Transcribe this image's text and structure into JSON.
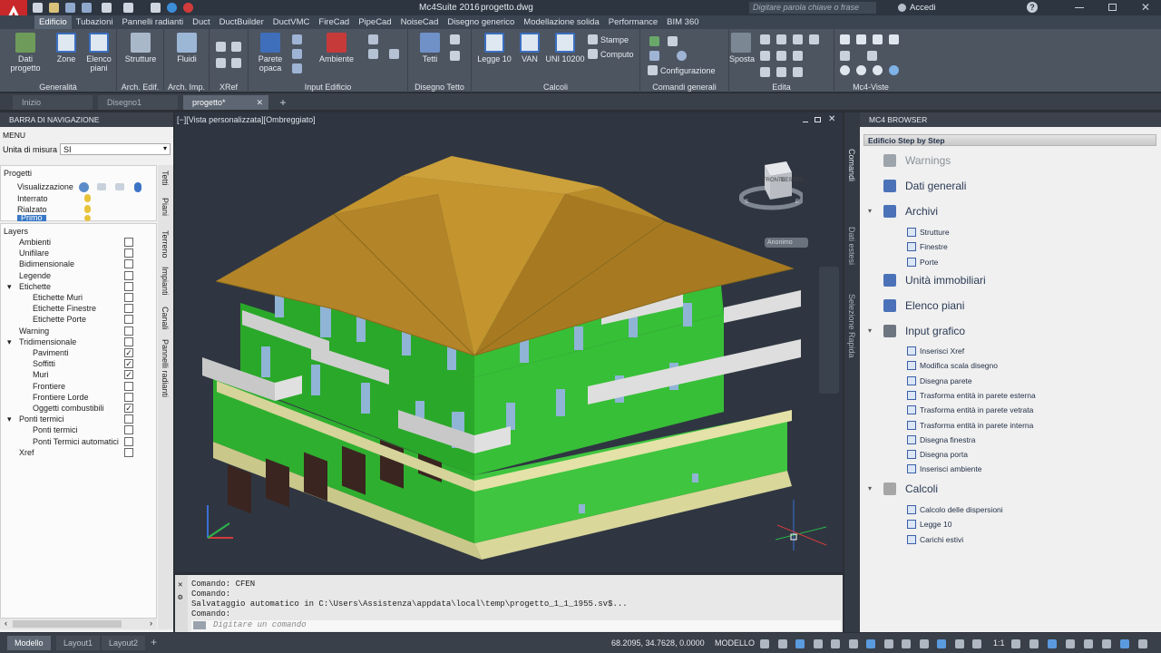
{
  "titlebar": {
    "app_title": "Mc4Suite 2016",
    "doc_title": "progetto.dwg",
    "search_placeholder": "Digitare parola chiave o frase",
    "user": "Accedi",
    "help": "?"
  },
  "ribbon_tabs": [
    "Edificio",
    "Tubazioni",
    "Pannelli radianti",
    "Duct",
    "DuctBuilder",
    "DuctVMC",
    "FireCad",
    "PipeCad",
    "NoiseCad",
    "Disegno generico",
    "Modellazione solida",
    "Performance",
    "BIM 360"
  ],
  "ribbon": {
    "generalita": {
      "title": "Generalità",
      "dati": "Dati\nprogetto",
      "zone": "Zone",
      "elenco": "Elenco\npiani"
    },
    "arch_edif": {
      "title": "Arch. Edif.",
      "strutture": "Strutture"
    },
    "arch_imp": {
      "title": "Arch. Imp.",
      "fluidi": "Fluidi"
    },
    "xref": {
      "title": "XRef"
    },
    "input": {
      "title": "Input Edificio",
      "parete": "Parete\nopaca",
      "ambiente": "Ambiente"
    },
    "tetto": {
      "title": "Disegno Tetto",
      "tetti": "Tetti"
    },
    "calcoli": {
      "title": "Calcoli",
      "legge10": "Legge 10",
      "van": "VAN",
      "uni": "UNI 10200",
      "stampe": "Stampe",
      "computo": "Computo"
    },
    "comandi": {
      "title": "Comandi generali",
      "configurazione": "Configurazione"
    },
    "edita": {
      "title": "Edita",
      "sposta": "Sposta"
    },
    "viste": {
      "title": "Mc4-Viste"
    }
  },
  "doc_tabs": [
    "Inizio",
    "Disegno1",
    "progetto*"
  ],
  "nav": {
    "title": "BARRA DI NAVIGAZIONE",
    "menu": "MENU",
    "unit_label": "Unita di misura",
    "unit_value": "SI",
    "progetti": "Progetti",
    "visualizzazione": "Visualizzazione",
    "floors": [
      "Interrato",
      "Rialzato",
      "Primo"
    ],
    "layers_title": "Layers",
    "layers": [
      {
        "label": "Ambienti",
        "level": 1,
        "checked": false
      },
      {
        "label": "Unifilare",
        "level": 1,
        "checked": false
      },
      {
        "label": "Bidimensionale",
        "level": 1,
        "checked": false
      },
      {
        "label": "Legende",
        "level": 1,
        "checked": false
      },
      {
        "label": "Etichette",
        "level": 1,
        "checked": false,
        "expand": "▾"
      },
      {
        "label": "Etichette Muri",
        "level": 2,
        "checked": false
      },
      {
        "label": "Etichette Finestre",
        "level": 2,
        "checked": false
      },
      {
        "label": "Etichette Porte",
        "level": 2,
        "checked": false
      },
      {
        "label": "Warning",
        "level": 1,
        "checked": false
      },
      {
        "label": "Tridimensionale",
        "level": 1,
        "checked": false,
        "expand": "▾"
      },
      {
        "label": "Pavimenti",
        "level": 2,
        "checked": true
      },
      {
        "label": "Soffitti",
        "level": 2,
        "checked": true
      },
      {
        "label": "Muri",
        "level": 2,
        "checked": true
      },
      {
        "label": "Frontiere",
        "level": 2,
        "checked": false
      },
      {
        "label": "Frontiere Lorde",
        "level": 2,
        "checked": false
      },
      {
        "label": "Oggetti combustibili",
        "level": 2,
        "checked": true
      },
      {
        "label": "Ponti termici",
        "level": 1,
        "checked": false,
        "expand": "▾"
      },
      {
        "label": "Ponti termici",
        "level": 2,
        "checked": false
      },
      {
        "label": "Ponti Termici automatici",
        "level": 2,
        "checked": false
      },
      {
        "label": "Xref",
        "level": 1,
        "checked": false
      }
    ],
    "vtabs": [
      "Tetti",
      "Piani",
      "Terreno",
      "Impianti",
      "Canali",
      "Pannelli radianti"
    ]
  },
  "viewport": {
    "label": "[−][Vista personalizzata][Ombreggiato]",
    "viewcube_front": "FRONTE",
    "viewcube_right": "DESTRA",
    "viewcube_badge": "Anonimo",
    "compass_s": "S",
    "compass_e": "E"
  },
  "cmdline": {
    "lines": [
      "Comando: CFEN",
      "Comando:",
      "Salvataggio automatico in C:\\Users\\Assistenza\\appdata\\local\\temp\\progetto_1_1_1955.sv$...",
      "Comando:"
    ],
    "placeholder": "Digitare un comando"
  },
  "side_tabs": [
    "Comandi",
    "Dati estesi",
    "Selezione Rapida"
  ],
  "browser": {
    "title": "MC4 BROWSER",
    "subtitle": "Edificio Step by Step",
    "warnings": "Warnings",
    "dati_generali": "Dati generali",
    "archivi": "Archivi",
    "archivi_items": [
      "Strutture",
      "Finestre",
      "Porte"
    ],
    "unita": "Unità immobiliari",
    "elenco_piani": "Elenco piani",
    "input_grafico": "Input grafico",
    "input_items": [
      "Inserisci Xref",
      "Modifica scala disegno",
      "Disegna parete",
      "Trasforma entità in parete esterna",
      "Trasforma entità in parete vetrata",
      "Trasforma entità in parete interna",
      "Disegna finestra",
      "Disegna porta",
      "Inserisci ambiente"
    ],
    "calcoli": "Calcoli",
    "calcoli_items": [
      "Calcolo delle dispersioni",
      "Legge 10",
      "Carichi estivi"
    ]
  },
  "status": {
    "layout_tabs": [
      "Modello",
      "Layout1",
      "Layout2"
    ],
    "coords": "68.2095, 34.7628, 0.0000",
    "mode": "MODELLO",
    "scale": "1:1"
  },
  "colors": {
    "wall": "#2fb52f",
    "roof": "#b8892e",
    "ribbon": "#4d5561"
  }
}
